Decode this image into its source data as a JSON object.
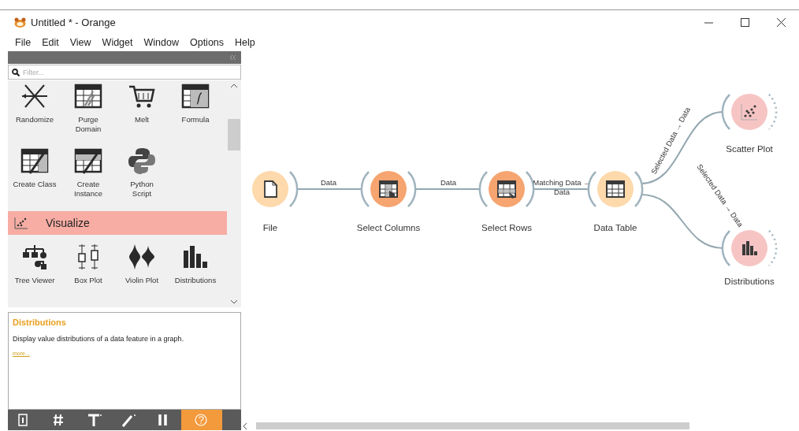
{
  "window": {
    "title": "Untitled * - Orange"
  },
  "menu": [
    {
      "label": "File"
    },
    {
      "label": "Edit"
    },
    {
      "label": "View"
    },
    {
      "label": "Widget"
    },
    {
      "label": "Window"
    },
    {
      "label": "Options"
    },
    {
      "label": "Help"
    }
  ],
  "toolbox": {
    "filter": {
      "placeholder": "Filter..."
    },
    "widgets": [
      {
        "kind": "widget",
        "label": "Randomize"
      },
      {
        "kind": "widget",
        "label": "Purge\nDomain"
      },
      {
        "kind": "widget",
        "label": "Melt"
      },
      {
        "kind": "widget",
        "label": "Formula"
      },
      {
        "kind": "widget",
        "label": "Create Class"
      },
      {
        "kind": "widget",
        "label": "Create\nInstance"
      },
      {
        "kind": "widget",
        "label": "Python\nScript"
      },
      {
        "kind": "category",
        "label": "Visualize"
      },
      {
        "kind": "widget",
        "label": "Tree Viewer"
      },
      {
        "kind": "widget",
        "label": "Box Plot"
      },
      {
        "kind": "widget",
        "label": "Violin Plot"
      },
      {
        "kind": "widget",
        "label": "Distributions"
      }
    ]
  },
  "help": {
    "title": "Distributions",
    "description": "Display value distributions of a data feature in a graph.",
    "link": "more..."
  },
  "tools": [
    {
      "selected": false
    },
    {
      "selected": false
    },
    {
      "selected": false
    },
    {
      "selected": false
    },
    {
      "selected": false
    },
    {
      "selected": true
    }
  ],
  "canvas": {
    "nodes": [
      {
        "label": "File",
        "color": "#fdd9ab",
        "has_input": false,
        "output_connected": true
      },
      {
        "label": "Select Columns",
        "color": "#f6a470",
        "has_input": true,
        "output_connected": true
      },
      {
        "label": "Select Rows",
        "color": "#f6a470",
        "has_input": true,
        "output_connected": true
      },
      {
        "label": "Data Table",
        "color": "#fdd9ab",
        "has_input": true,
        "output_connected": true
      },
      {
        "label": "Scatter Plot",
        "color": "#f7c4c4",
        "has_input": true,
        "output_connected": false
      },
      {
        "label": "Distributions",
        "color": "#f7c4c4",
        "has_input": true,
        "output_connected": false
      }
    ],
    "links": [
      {
        "label": "Data"
      },
      {
        "label": "Data"
      },
      {
        "label": "Matching Data →",
        "label_2": "Data"
      },
      {
        "label": "Selected Data → Data"
      },
      {
        "label": "Selected Data → Data"
      }
    ]
  }
}
